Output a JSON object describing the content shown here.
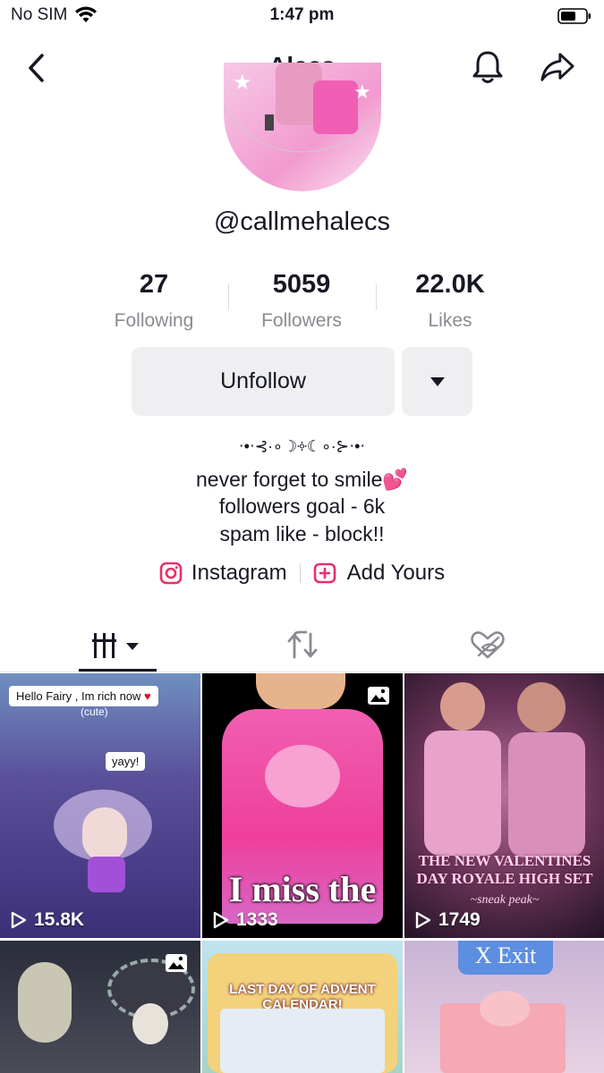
{
  "status_bar": {
    "carrier": "No SIM",
    "time": "1:47 pm"
  },
  "nav": {
    "title": "Alecs"
  },
  "profile": {
    "username": "@callmehalecs",
    "stats": [
      {
        "value": "27",
        "label": "Following"
      },
      {
        "value": "5059",
        "label": "Followers"
      },
      {
        "value": "22.0K",
        "label": "Likes"
      }
    ],
    "unfollow_label": "Unfollow",
    "bio": [
      "⋅•⋅⊰∙∘☽༓☾∘∙⊱⋅•⋅",
      "never forget to smile💕",
      "followers goal - 6k",
      "spam like - block!!"
    ],
    "links": {
      "instagram": "Instagram",
      "add_yours": "Add Yours"
    }
  },
  "grid": {
    "tiles": [
      {
        "views": "15.8K",
        "chat1": "Hello Fairy , Im rich now",
        "chat2": "yayy!",
        "chat3": "(cute)"
      },
      {
        "views": "1333",
        "overlay": "I miss the",
        "photo": true
      },
      {
        "views": "1749",
        "overlay": "THE NEW VALENTINES DAY ROYALE HIGH SET",
        "sub": "~sneak peak~"
      },
      {
        "photo": true
      },
      {
        "overlay": "LAST DAY OF ADVENT CALENDAR!"
      },
      {
        "overlay": "X Exit"
      }
    ]
  },
  "colors": {
    "accent_pink": "#e8306a",
    "button_bg": "#efeff1",
    "muted": "#8a8b91"
  }
}
